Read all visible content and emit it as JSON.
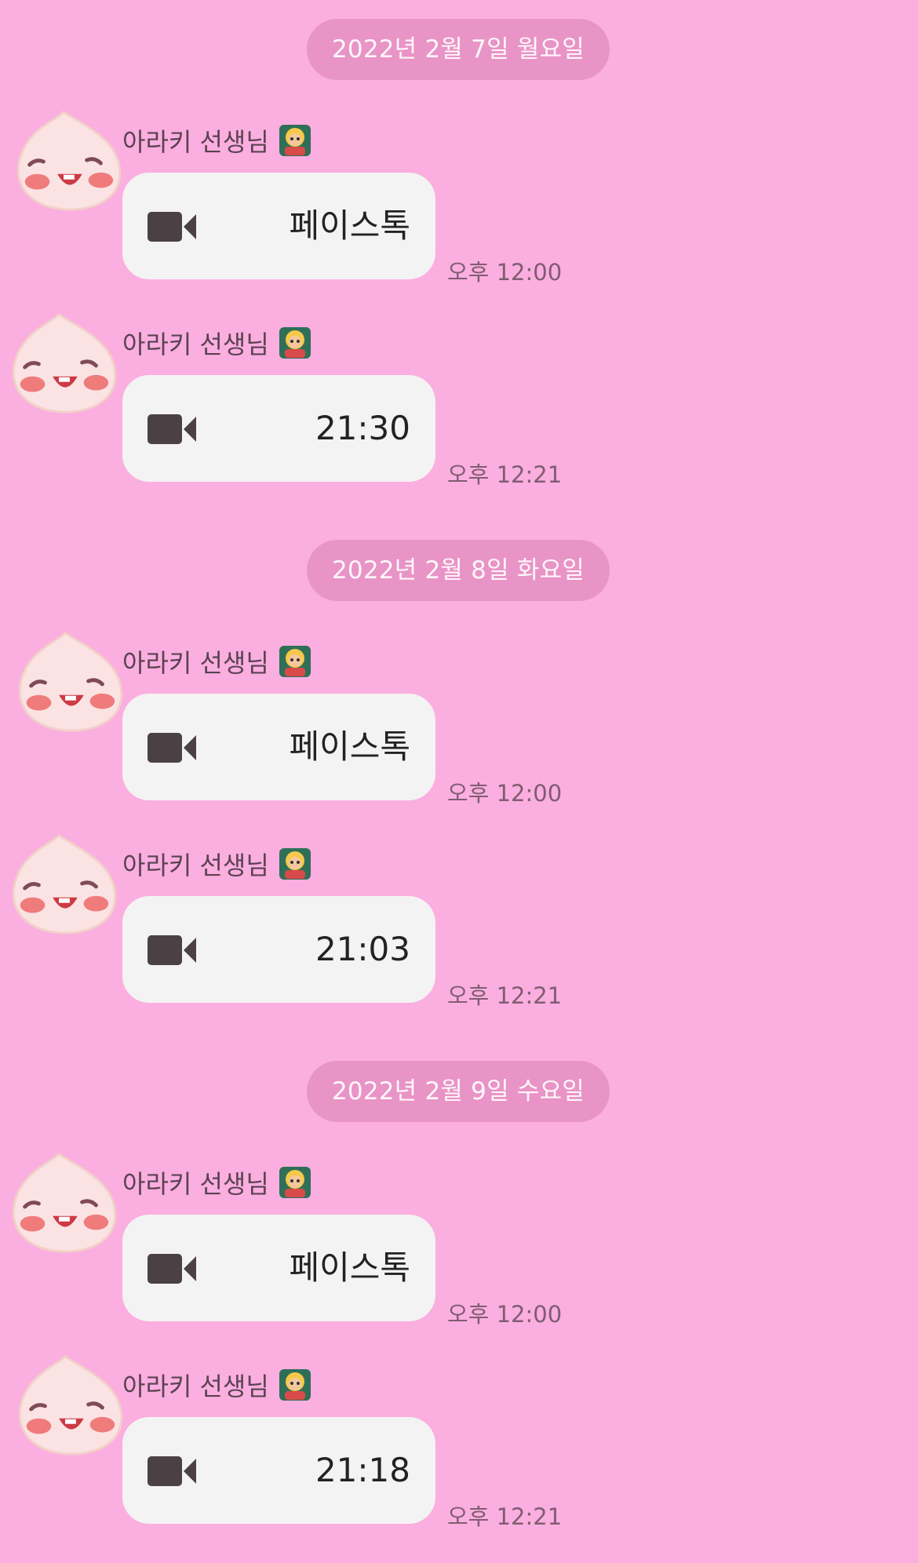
{
  "chat": {
    "dates": [
      "2022년 2월 7일 월요일",
      "2022년 2월 8일 화요일",
      "2022년 2월 9일 수요일"
    ],
    "sender_name": "아라키 선생님",
    "messages": [
      {
        "call_label": "페이스톡",
        "time": "오후 12:00"
      },
      {
        "call_label": "21:30",
        "time": "오후 12:21"
      },
      {
        "call_label": "페이스톡",
        "time": "오후 12:00"
      },
      {
        "call_label": "21:03",
        "time": "오후 12:21"
      },
      {
        "call_label": "페이스톡",
        "time": "오후 12:00"
      },
      {
        "call_label": "21:18",
        "time": "오후 12:21"
      }
    ]
  },
  "colors": {
    "background": "#fbaee0",
    "date_pill": "#e994c6",
    "bubble": "#f4f3f3",
    "time_text": "#7f5d71"
  },
  "icons": {
    "avatar": "apeach-avatar-icon",
    "teacher": "teacher-emoji-icon",
    "video": "video-camera-icon"
  }
}
